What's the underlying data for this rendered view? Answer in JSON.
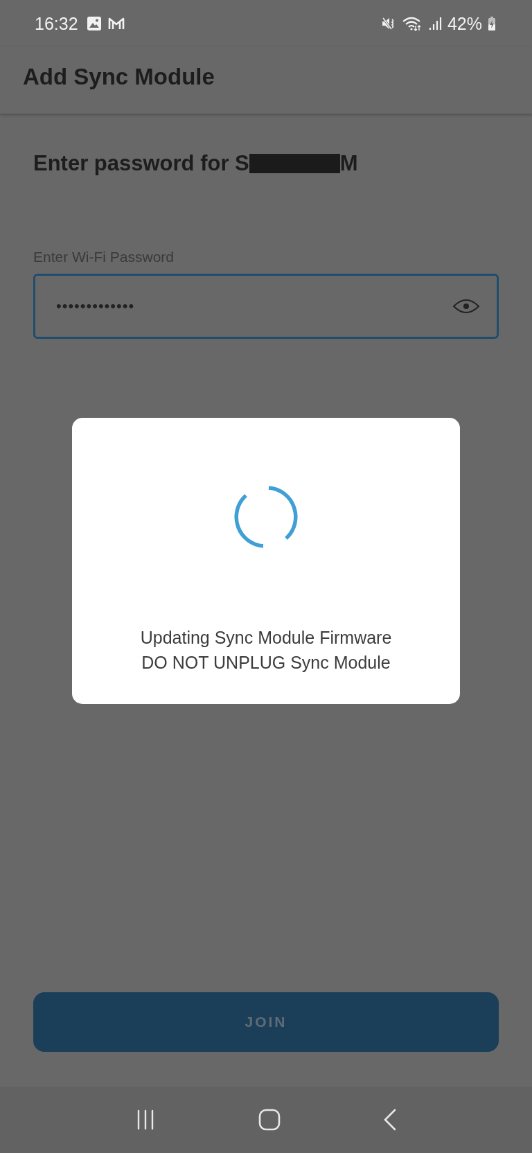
{
  "status_bar": {
    "time": "16:32",
    "battery": "42%"
  },
  "app_bar": {
    "title": "Add Sync Module"
  },
  "heading": {
    "before": "Enter password for S",
    "redacted": true,
    "after": "M"
  },
  "password_field": {
    "label": "Enter Wi-Fi Password",
    "value": "•••••••••••••",
    "focused": true
  },
  "dialog": {
    "lines": [
      "Updating Sync Module Firmware",
      "DO NOT UNPLUG Sync Module"
    ]
  },
  "join_button": {
    "label": "JOIN",
    "disabled": true
  }
}
